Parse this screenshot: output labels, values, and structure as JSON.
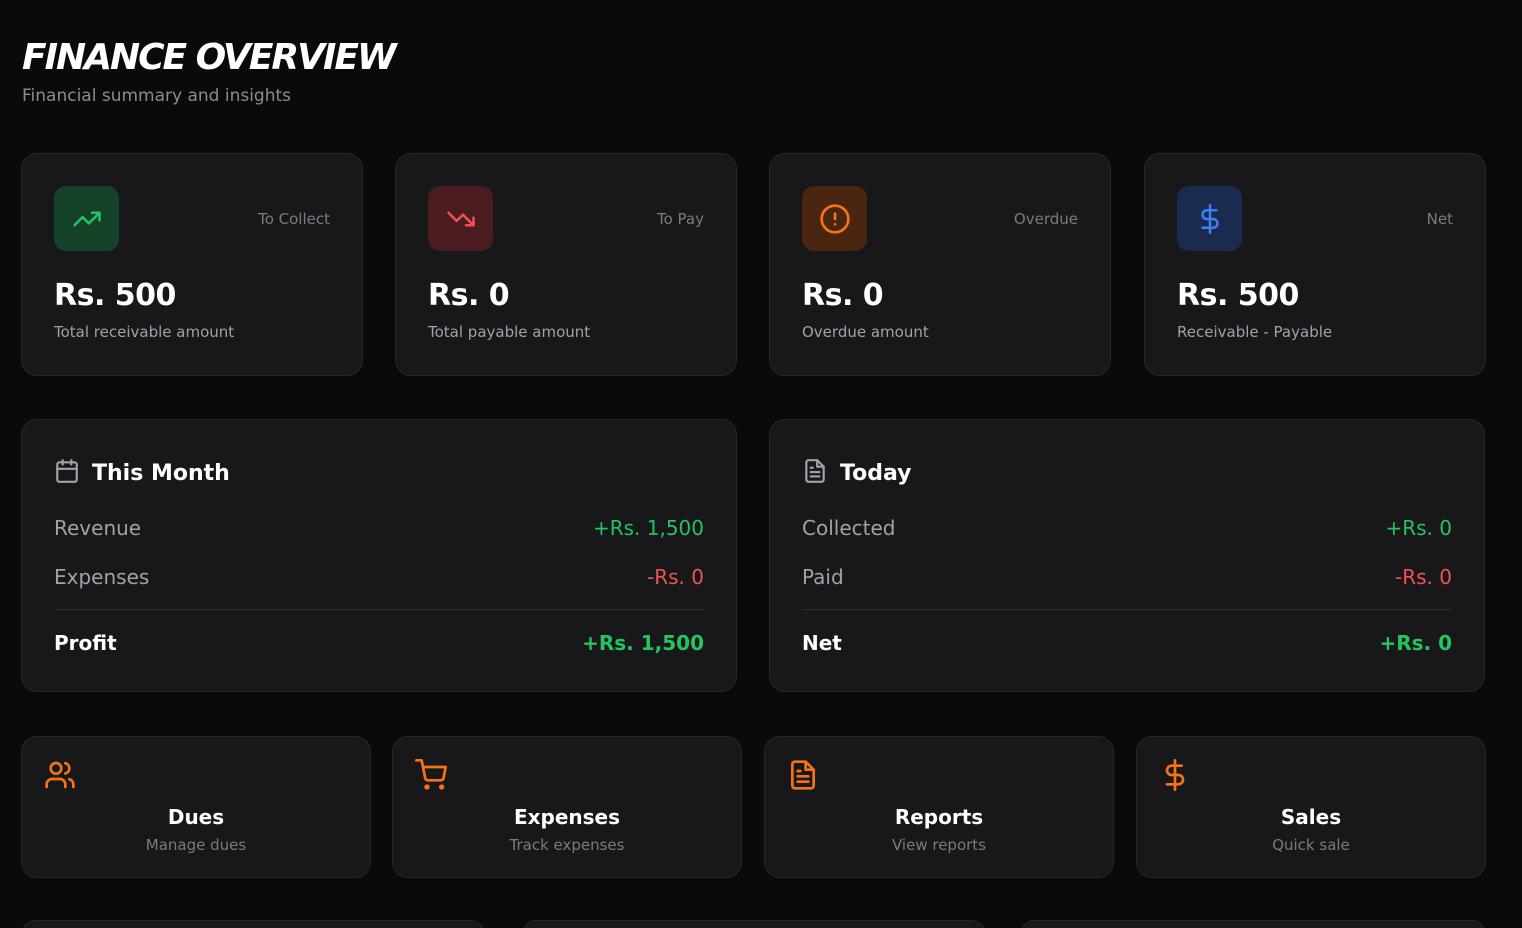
{
  "header": {
    "title": "FINANCE OVERVIEW",
    "subtitle": "Financial summary and insights"
  },
  "stats": [
    {
      "tag": "To Collect",
      "amount": "Rs. 500",
      "desc": "Total receivable amount",
      "icon": "trending-up-icon",
      "color": "#22c55e",
      "bg": "#14432a"
    },
    {
      "tag": "To Pay",
      "amount": "Rs. 0",
      "desc": "Total payable amount",
      "icon": "trending-down-icon",
      "color": "#f05252",
      "bg": "#4a1b1f"
    },
    {
      "tag": "Overdue",
      "amount": "Rs. 0",
      "desc": "Overdue amount",
      "icon": "alert-circle-icon",
      "color": "#f97316",
      "bg": "#4a2510"
    },
    {
      "tag": "Net",
      "amount": "Rs. 500",
      "desc": "Receivable - Payable",
      "icon": "dollar-icon",
      "color": "#3b82f6",
      "bg": "#1b2a4f"
    }
  ],
  "this_month": {
    "title": "This Month",
    "icon": "calendar-icon",
    "rows": [
      {
        "label": "Revenue",
        "value": "+Rs. 1,500"
      },
      {
        "label": "Expenses",
        "value": "-Rs. 0"
      }
    ],
    "total": {
      "label": "Profit",
      "value": "+Rs. 1,500"
    }
  },
  "today": {
    "title": "Today",
    "icon": "document-icon",
    "rows": [
      {
        "label": "Collected",
        "value": "+Rs. 0"
      },
      {
        "label": "Paid",
        "value": "-Rs. 0"
      }
    ],
    "total": {
      "label": "Net",
      "value": "+Rs. 0"
    }
  },
  "actions": [
    {
      "name": "Dues",
      "sub": "Manage dues",
      "icon": "users-icon"
    },
    {
      "name": "Expenses",
      "sub": "Track expenses",
      "icon": "cart-icon"
    },
    {
      "name": "Reports",
      "sub": "View reports",
      "icon": "file-text-icon"
    },
    {
      "name": "Sales",
      "sub": "Quick sale",
      "icon": "dollar-icon"
    }
  ],
  "colors": {
    "accent": "#f97316",
    "positive": "#22c55e",
    "negative": "#f05252"
  }
}
